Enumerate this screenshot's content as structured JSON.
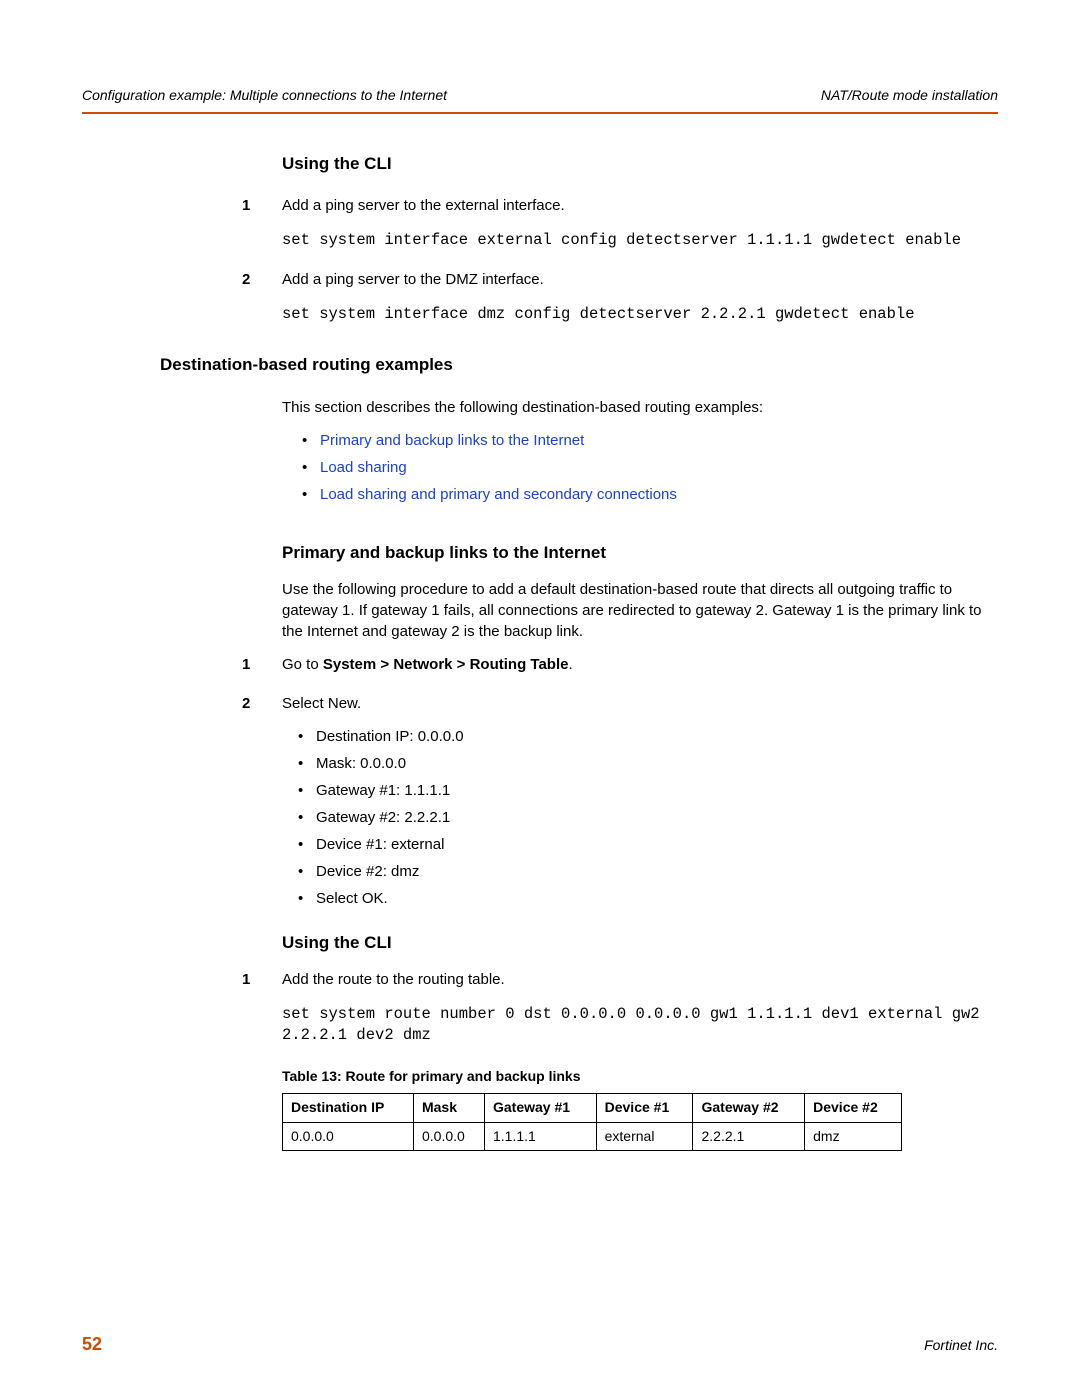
{
  "header": {
    "left": "Configuration example: Multiple connections to the Internet",
    "right": "NAT/Route mode installation"
  },
  "sections": {
    "using_cli_1_title": "Using the CLI",
    "step1_text": "Add a ping server to the external interface.",
    "step1_code": "set system interface external config detectserver 1.1.1.1 gwdetect enable",
    "step2_text": "Add a ping server to the DMZ interface.",
    "step2_code": "set system interface dmz config detectserver 2.2.2.1 gwdetect enable",
    "dest_title": "Destination-based routing examples",
    "dest_intro": "This section describes the following destination-based routing examples:",
    "link1": "Primary and backup links to the Internet",
    "link2": "Load sharing",
    "link3": "Load sharing and primary and secondary connections",
    "primary_title": "Primary and backup links to the Internet",
    "primary_para": "Use the following procedure to add a default destination-based route that directs all outgoing traffic to gateway 1. If gateway 1 fails, all connections are redirected to gateway 2. Gateway 1 is the primary link to the Internet and gateway 2 is the backup link.",
    "pb_step1_prefix": "Go to ",
    "pb_step1_bold": "System > Network > Routing Table",
    "pb_step1_suffix": ".",
    "pb_step2": "Select New.",
    "pb_b1": "Destination IP: 0.0.0.0",
    "pb_b2": "Mask: 0.0.0.0",
    "pb_b3": "Gateway #1: 1.1.1.1",
    "pb_b4": "Gateway #2: 2.2.2.1",
    "pb_b5": "Device #1: external",
    "pb_b6": "Device #2: dmz",
    "pb_b7": "Select OK.",
    "using_cli_2_title": "Using the CLI",
    "cli2_step1_text": "Add the route to the routing table.",
    "cli2_step1_code": "set system route number 0 dst 0.0.0.0 0.0.0.0 gw1 1.1.1.1 dev1 external gw2 2.2.2.1 dev2 dmz",
    "table_caption": "Table 13: Route for primary and backup links",
    "table": {
      "headers": [
        "Destination IP",
        "Mask",
        "Gateway #1",
        "Device #1",
        "Gateway #2",
        "Device #2"
      ],
      "row": [
        "0.0.0.0",
        "0.0.0.0",
        "1.1.1.1",
        "external",
        "2.2.2.1",
        "dmz"
      ]
    }
  },
  "footer": {
    "page": "52",
    "company": "Fortinet Inc."
  }
}
